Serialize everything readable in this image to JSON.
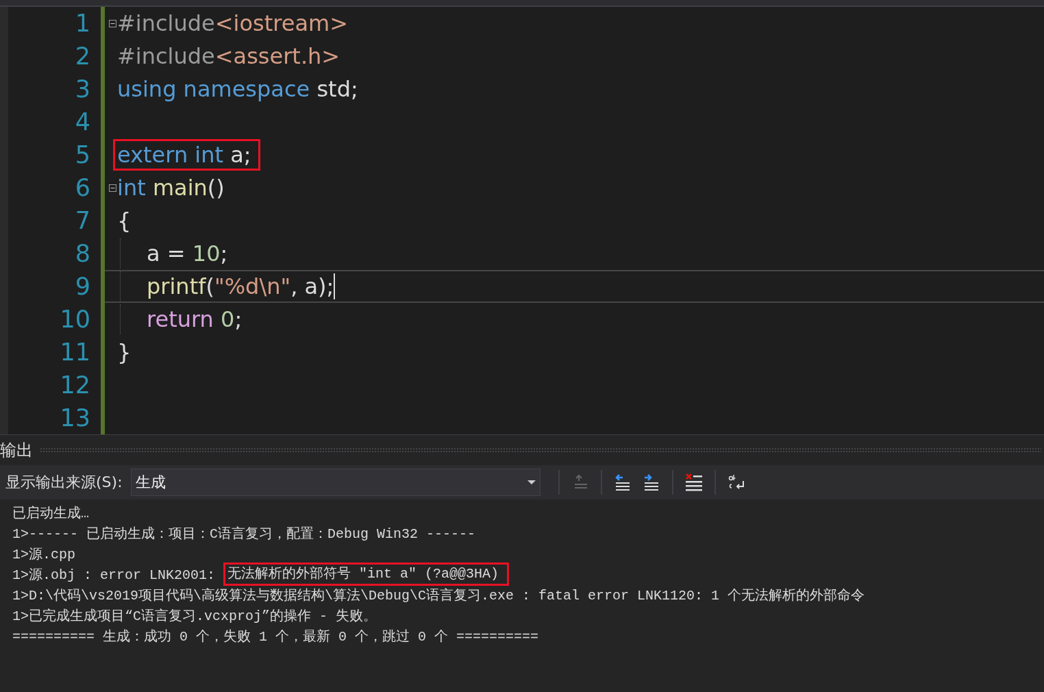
{
  "editor": {
    "lines": [
      {
        "number": "1",
        "fold": true,
        "indented": false,
        "current": false,
        "marked": false,
        "tokens": [
          {
            "text": "#include",
            "kind": "preproc"
          },
          {
            "text": "<iostream>",
            "kind": "string"
          }
        ]
      },
      {
        "number": "2",
        "fold": false,
        "indented": false,
        "current": false,
        "marked": false,
        "tokens": [
          {
            "text": "#include",
            "kind": "preproc"
          },
          {
            "text": "<assert.h>",
            "kind": "string"
          }
        ]
      },
      {
        "number": "3",
        "fold": false,
        "indented": false,
        "current": false,
        "marked": false,
        "tokens": [
          {
            "text": "using namespace",
            "kind": "keyword"
          },
          {
            "text": " std;",
            "kind": "plain"
          }
        ]
      },
      {
        "number": "4",
        "fold": false,
        "indented": false,
        "current": false,
        "marked": false
      },
      {
        "number": "5",
        "fold": false,
        "indented": false,
        "current": false,
        "marked": true,
        "tokens": [
          {
            "text": "extern int",
            "kind": "keyword"
          },
          {
            "text": " a;",
            "kind": "plain"
          }
        ]
      },
      {
        "number": "6",
        "fold": true,
        "indented": false,
        "current": false,
        "marked": false,
        "tokens": [
          {
            "text": "int",
            "kind": "keyword"
          },
          {
            "text": " main",
            "kind": "function"
          },
          {
            "text": "()",
            "kind": "plain"
          }
        ]
      },
      {
        "number": "7",
        "fold": false,
        "indented": false,
        "current": false,
        "marked": false,
        "tokens": [
          {
            "text": "{",
            "kind": "plain"
          }
        ]
      },
      {
        "number": "8",
        "fold": false,
        "indented": true,
        "current": false,
        "marked": false,
        "tokens": [
          {
            "text": "a = ",
            "kind": "plain"
          },
          {
            "text": "10",
            "kind": "number"
          },
          {
            "text": ";",
            "kind": "plain"
          }
        ]
      },
      {
        "number": "9",
        "fold": false,
        "indented": true,
        "current": true,
        "marked": false,
        "tokens": [
          {
            "text": "printf",
            "kind": "function"
          },
          {
            "text": "(",
            "kind": "plain"
          },
          {
            "text": "\"%d\\n\"",
            "kind": "string"
          },
          {
            "text": ", a);",
            "kind": "plain"
          }
        ]
      },
      {
        "number": "10",
        "fold": false,
        "indented": true,
        "current": false,
        "marked": false,
        "tokens": [
          {
            "text": "return",
            "kind": "control"
          },
          {
            "text": " 0",
            "kind": "number"
          },
          {
            "text": ";",
            "kind": "plain"
          }
        ]
      },
      {
        "number": "11",
        "fold": false,
        "indented": false,
        "current": false,
        "marked": false,
        "tokens": [
          {
            "text": "}",
            "kind": "plain"
          }
        ]
      },
      {
        "number": "12",
        "fold": false,
        "indented": false,
        "current": false,
        "marked": false
      },
      {
        "number": "13",
        "fold": false,
        "indented": false,
        "current": false,
        "marked": false
      }
    ]
  },
  "output": {
    "title": "输出",
    "source_label": "显示输出来源(S):",
    "source_value": "生成",
    "toolbar": [
      {
        "kind": "go-to-source",
        "disabled": true
      },
      {
        "kind": "previous",
        "disabled": false
      },
      {
        "kind": "next",
        "disabled": false
      },
      {
        "kind": "clear",
        "disabled": false
      },
      {
        "kind": "wrap",
        "disabled": false
      }
    ],
    "lines": [
      {
        "text": "已启动生成…"
      },
      {
        "text": "1>------ 已启动生成：项目：C语言复习，配置：Debug Win32 ------"
      },
      {
        "text": "1>源.cpp"
      },
      {
        "text": "1>源.obj : error LNK2001: ",
        "marked": "无法解析的外部符号 \"int a\" (?a@@3HA)"
      },
      {
        "text": "1>D:\\代码\\vs2019项目代码\\高级算法与数据结构\\算法\\Debug\\C语言复习.exe : fatal error LNK1120: 1 个无法解析的外部命令"
      },
      {
        "text": "1>已完成生成项目“C语言复习.vcxproj”的操作 - 失败。"
      },
      {
        "text": "========== 生成：成功 0 个，失败 1 个，最新 0 个，跳过 0 个 =========="
      }
    ]
  }
}
